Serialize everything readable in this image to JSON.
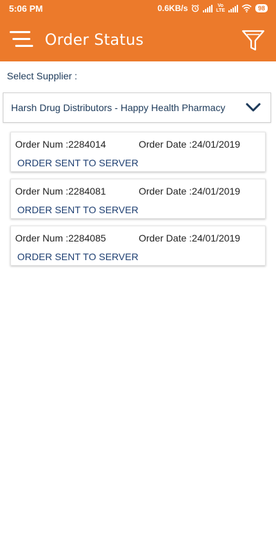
{
  "status_bar": {
    "time": "5:06 PM",
    "network_speed": "0.6KB/s",
    "alarm_icon": "alarm-icon",
    "signal_icon": "signal-icon",
    "volte_top": "Vo",
    "volte_bottom": "LTE",
    "wifi_icon": "wifi-icon",
    "battery": "98"
  },
  "header": {
    "title": "Order Status",
    "menu_icon": "menu-icon",
    "filter_icon": "filter-icon",
    "color": "#ec7a2b"
  },
  "supplier": {
    "label": "Select Supplier :",
    "selected": "Harsh Drug Distributors - Happy Health Pharmacy",
    "chevron_icon": "chevron-down-icon"
  },
  "orders": [
    {
      "num": "Order Num :2284014",
      "date": "Order Date :24/01/2019",
      "status": "ORDER SENT TO SERVER"
    },
    {
      "num": "Order Num :2284081",
      "date": "Order Date :24/01/2019",
      "status": "ORDER SENT TO SERVER"
    },
    {
      "num": "Order Num :2284085",
      "date": "Order Date :24/01/2019",
      "status": "ORDER SENT TO SERVER"
    }
  ]
}
